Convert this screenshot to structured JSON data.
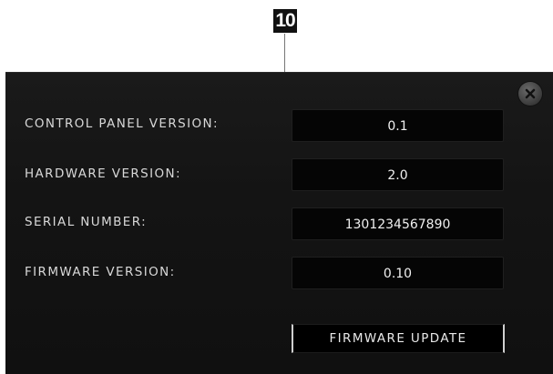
{
  "callout": {
    "number": "10"
  },
  "dialog": {
    "close_icon": "close-icon",
    "rows": [
      {
        "label": "CONTROL PANEL VERSION:",
        "value": "0.1"
      },
      {
        "label": "HARDWARE VERSION:",
        "value": "2.0"
      },
      {
        "label": "SERIAL NUMBER:",
        "value": "1301234567890"
      },
      {
        "label": "FIRMWARE VERSION:",
        "value": "0.10"
      }
    ],
    "firmware_update_label": "FIRMWARE UPDATE"
  },
  "colors": {
    "panel_background": "#141414",
    "value_box_background": "#050505",
    "label_text": "#d8d8d8",
    "value_text": "#f0f0f0"
  }
}
